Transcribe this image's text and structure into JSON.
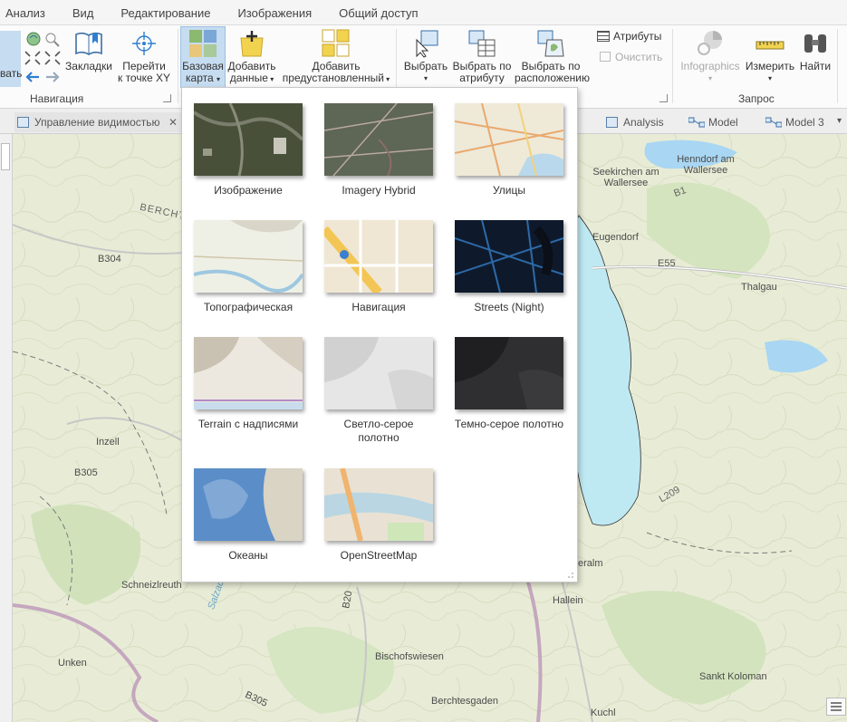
{
  "menu": {
    "tabs": [
      "Анализ",
      "Вид",
      "Редактирование",
      "Изображения",
      "Общий доступ"
    ]
  },
  "ribbon": {
    "navigation": {
      "cut_label": "вать",
      "bookmarks": "Закладки",
      "goto_xy": [
        "Перейти",
        "к точке XY"
      ],
      "group": "Навигация"
    },
    "layer": {
      "basemap": [
        "Базовая",
        "карта"
      ],
      "add_data": [
        "Добавить",
        "данные"
      ],
      "add_preset": [
        "Добавить",
        "предустановленный"
      ]
    },
    "selection": {
      "select": "Выбрать",
      "select_by_attr": [
        "Выбрать по",
        "атрибуту"
      ],
      "select_by_loc": [
        "Выбрать по",
        "расположению"
      ],
      "attributes": "Атрибуты",
      "clear": "Очистить"
    },
    "inquiry": {
      "infographics": "Infographics",
      "measure": "Измерить",
      "find": "Найти",
      "group": "Запрос"
    }
  },
  "view_tabs": {
    "left_tab": "Управление видимостью",
    "close": "✕",
    "right_tabs": [
      "Analysis",
      "Model",
      "Model 3"
    ]
  },
  "gallery": {
    "items": [
      {
        "label": "Изображение",
        "icon": "imagery-thumbnail"
      },
      {
        "label": "Imagery Hybrid",
        "icon": "imagery-hybrid-thumbnail"
      },
      {
        "label": "Улицы",
        "icon": "streets-thumbnail"
      },
      {
        "label": "Топографическая",
        "icon": "topographic-thumbnail"
      },
      {
        "label": "Навигация",
        "icon": "navigation-thumbnail"
      },
      {
        "label": "Streets (Night)",
        "icon": "streets-night-thumbnail"
      },
      {
        "label": "Terrain с надписями",
        "icon": "terrain-labels-thumbnail"
      },
      {
        "label": "Светло-серое полотно",
        "icon": "light-gray-thumbnail"
      },
      {
        "label": "Темно-серое полотно",
        "icon": "dark-gray-thumbnail"
      },
      {
        "label": "Океаны",
        "icon": "oceans-thumbnail"
      },
      {
        "label": "OpenStreetMap",
        "icon": "openstreetmap-thumbnail"
      }
    ]
  },
  "map": {
    "labels": {
      "seekirchen": "Seekirchen am Wallersee",
      "henndorf": "Henndorf am Wallersee",
      "eugendorf": "Eugendorf",
      "thalgau": "Thalgau",
      "e55": "E55",
      "bercht": "BERCHT",
      "b304": "B304",
      "inzell": "Inzell",
      "b305": "B305",
      "schneizlreuth": "Schneizlreuth",
      "b20": "B20",
      "hallein": "Hallein",
      "eralm": "eralm",
      "bischofswiesen": "Bischofswiesen",
      "unken": "Unken",
      "b305b": "B305",
      "berchtesgaden": "Berchtesgaden",
      "sankt_koloman": "Sankt Koloman",
      "kuchl": "Kuchl",
      "l209": "L209",
      "b1": "B1",
      "salzach": "Salzach"
    }
  },
  "colors": {
    "accent": "#cde3f6",
    "water": "#bfe9f2",
    "map_bg": "#e9ecd9"
  }
}
